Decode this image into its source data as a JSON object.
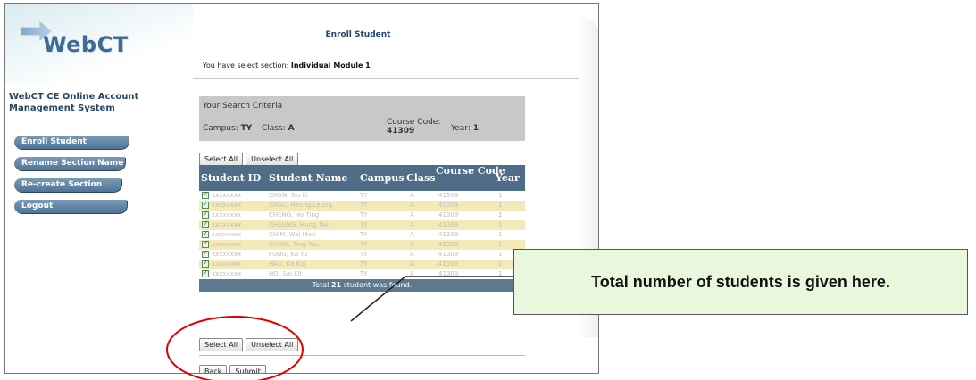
{
  "sidebar": {
    "logo": "WebCT",
    "system_title": "WebCT CE Online Account Management System",
    "menu": [
      {
        "label": "Enroll Student"
      },
      {
        "label": "Rename Section Name"
      },
      {
        "label": "Re-create Section"
      },
      {
        "label": "Logout"
      }
    ]
  },
  "main": {
    "heading": "Enroll Student",
    "section_prefix": "You have select section:",
    "section_name": "Individual Module 1"
  },
  "criteria": {
    "title": "Your Search Criteria",
    "campus_label": "Campus:",
    "campus_value": "TY",
    "class_label": "Class:",
    "class_value": "A",
    "course_code_label": "Course Code:",
    "course_code_value": "41309",
    "year_label": "Year:",
    "year_value": "1"
  },
  "buttons": {
    "select_all": "Select All",
    "unselect_all": "Unselect All",
    "back": "Back",
    "submit": "Submit"
  },
  "table": {
    "headers": {
      "student_id": "Student ID",
      "student_name": "Student Name",
      "campus": "Campus",
      "class": "Class",
      "course_code": "Course Code",
      "year": "Year"
    },
    "rows": [
      {
        "id": "xxxxxxxx",
        "name": "CHAN, Siu Ki",
        "campus": "TY",
        "class": "A",
        "code": "41309",
        "year": "1"
      },
      {
        "id": "xxxxxxxx",
        "name": "CHAU, Heung Leung",
        "campus": "TY",
        "class": "A",
        "code": "41309",
        "year": "1"
      },
      {
        "id": "xxxxxxxx",
        "name": "CHENG, Ho Ting",
        "campus": "TY",
        "class": "A",
        "code": "41309",
        "year": "1"
      },
      {
        "id": "xxxxxxxx",
        "name": "CHEUNG, Hung Tak",
        "campus": "TY",
        "class": "A",
        "code": "41309",
        "year": "1"
      },
      {
        "id": "xxxxxxxx",
        "name": "CHIM, Wai Man",
        "campus": "TY",
        "class": "A",
        "code": "41309",
        "year": "1"
      },
      {
        "id": "xxxxxxxx",
        "name": "CHOW, Ting Yau",
        "campus": "TY",
        "class": "A",
        "code": "41309",
        "year": "1"
      },
      {
        "id": "xxxxxxxx",
        "name": "FUNG, Ka Yu",
        "campus": "TY",
        "class": "A",
        "code": "41309",
        "year": "1"
      },
      {
        "id": "xxxxxxxx",
        "name": "HAU, Ka Kui",
        "campus": "TY",
        "class": "A",
        "code": "41309",
        "year": "1"
      },
      {
        "id": "xxxxxxxx",
        "name": "HO, Sai Kit",
        "campus": "TY",
        "class": "A",
        "code": "41309",
        "year": "1"
      }
    ],
    "footer_prefix": "Total",
    "footer_count": "21",
    "footer_suffix": "student was found."
  },
  "callout": {
    "text": "Total number of students is given here."
  },
  "colors": {
    "header_bg": "#4f6d88",
    "alt_row": "#f6e9b8",
    "callout_bg": "#e9f8dc",
    "highlight": "#e00000"
  }
}
